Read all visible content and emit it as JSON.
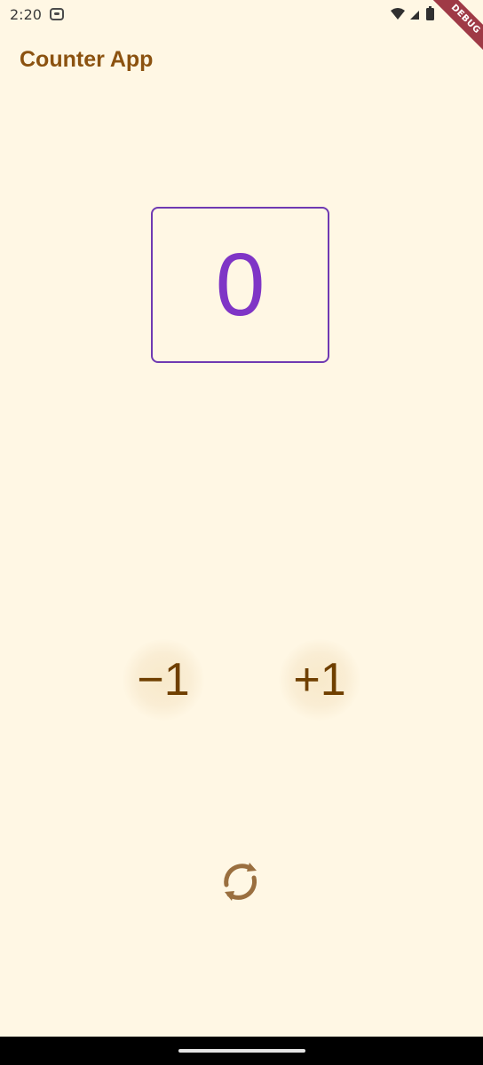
{
  "status_bar": {
    "time": "2:20",
    "left_icon": "messenger-icon",
    "right_icons": [
      "wifi-icon",
      "signal-icon",
      "battery-icon"
    ],
    "debug_label": "DEBUG"
  },
  "app_bar": {
    "title": "Counter App"
  },
  "counter": {
    "value": "0"
  },
  "actions": {
    "decrement_label": "−1",
    "increment_label": "+1",
    "reset_icon": "refresh-icon"
  },
  "colors": {
    "background": "#fff7e4",
    "title": "#8b5210",
    "counter_text": "#7f35c6",
    "counter_border": "#6f3ab2",
    "button_text": "#6f3f00",
    "debug_banner": "#9f3a46"
  }
}
